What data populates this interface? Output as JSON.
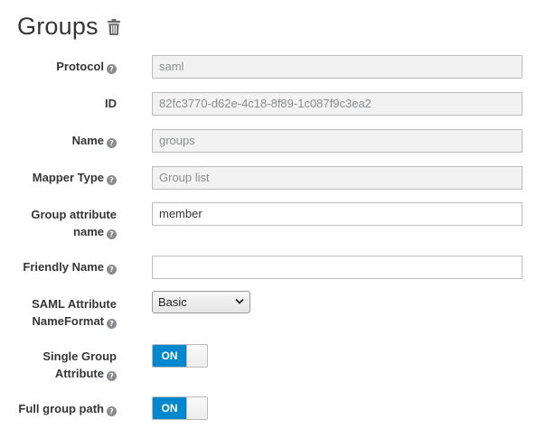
{
  "page": {
    "title": "Groups",
    "delete_icon": "trash-icon"
  },
  "form": {
    "protocol": {
      "label": "Protocol",
      "value": "saml"
    },
    "id": {
      "label": "ID",
      "value": "82fc3770-d62e-4c18-8f89-1c087f9c3ea2"
    },
    "name": {
      "label": "Name",
      "value": "groups"
    },
    "mapper_type": {
      "label": "Mapper Type",
      "value": "Group list"
    },
    "group_attribute_name": {
      "label_line1": "Group attribute",
      "label_line2": "name",
      "value": "member"
    },
    "friendly_name": {
      "label": "Friendly Name",
      "value": ""
    },
    "saml_attribute_nameformat": {
      "label_line1": "SAML Attribute",
      "label_line2": "NameFormat",
      "selected": "Basic"
    },
    "single_group_attribute": {
      "label_line1": "Single Group",
      "label_line2": "Attribute",
      "state": "ON"
    },
    "full_group_path": {
      "label": "Full group path",
      "state": "ON"
    }
  },
  "help_glyph": "?",
  "colors": {
    "toggle_on": "#0088ce",
    "readonly_bg": "#f2f2f2"
  }
}
